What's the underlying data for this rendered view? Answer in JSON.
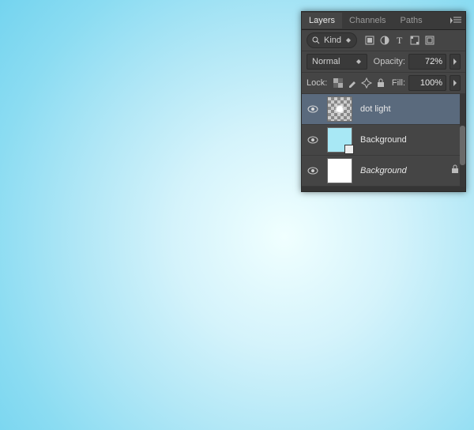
{
  "tabs": {
    "layers": "Layers",
    "channels": "Channels",
    "paths": "Paths"
  },
  "filter": {
    "label": "Kind"
  },
  "blend": {
    "mode": "Normal",
    "opacity_label": "Opacity:",
    "opacity_value": "72%"
  },
  "lock": {
    "label": "Lock:",
    "fill_label": "Fill:",
    "fill_value": "100%"
  },
  "layers": [
    {
      "name": "dot light"
    },
    {
      "name": "Background"
    },
    {
      "name": "Background"
    }
  ],
  "colors": {
    "bg_layer": "#a8e8f5"
  }
}
